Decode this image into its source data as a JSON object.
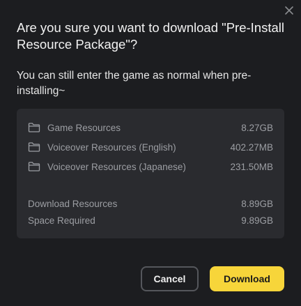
{
  "dialog": {
    "title": "Are you sure you want to download \"Pre-Install Resource Package\"?",
    "subtitle": "You can still enter the game as normal when pre-installing~",
    "close_icon": "close-icon"
  },
  "resources": [
    {
      "icon": "folder-icon",
      "name": "Game Resources",
      "size": "8.27GB"
    },
    {
      "icon": "folder-icon",
      "name": "Voiceover Resources (English)",
      "size": "402.27MB"
    },
    {
      "icon": "folder-icon",
      "name": "Voiceover Resources (Japanese)",
      "size": "231.50MB"
    }
  ],
  "summary": {
    "download": {
      "label": "Download Resources",
      "value": "8.89GB"
    },
    "space": {
      "label": "Space Required",
      "value": "9.89GB"
    }
  },
  "buttons": {
    "cancel": "Cancel",
    "download": "Download"
  },
  "colors": {
    "background": "#1c1d20",
    "panel": "#2a2b2f",
    "accent": "#f7d53a",
    "muted_text": "#9c9ea3"
  }
}
